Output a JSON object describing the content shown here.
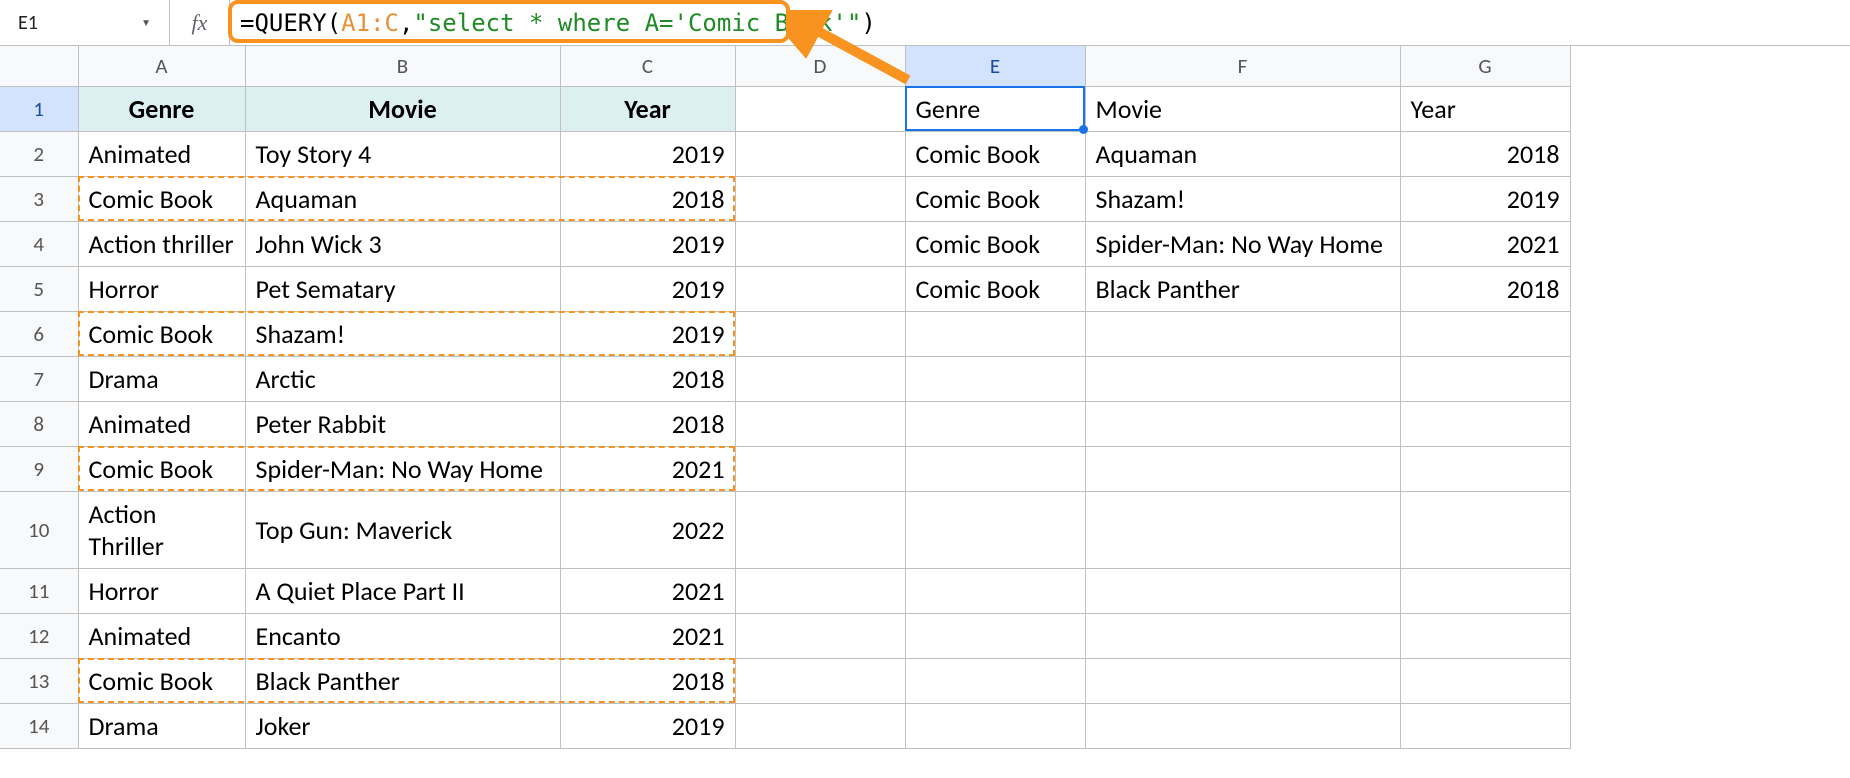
{
  "namebox": {
    "value": "E1"
  },
  "formula": {
    "eq": "=",
    "fn": "QUERY",
    "open": "(",
    "range": "A1:C",
    "comma": ",",
    "str": "\"select * where A='Comic Book'\"",
    "close": ")"
  },
  "columns": [
    "A",
    "B",
    "C",
    "D",
    "E",
    "F",
    "G"
  ],
  "rowNumbers": [
    "1",
    "2",
    "3",
    "4",
    "5",
    "6",
    "7",
    "8",
    "9",
    "10",
    "11",
    "12",
    "13",
    "14"
  ],
  "left": {
    "headers": {
      "genre": "Genre",
      "movie": "Movie",
      "year": "Year"
    },
    "rows": [
      {
        "genre": "Animated",
        "movie": "Toy Story 4",
        "year": "2019"
      },
      {
        "genre": "Comic Book",
        "movie": "Aquaman",
        "year": "2018"
      },
      {
        "genre": "Action thriller",
        "movie": "John Wick 3",
        "year": "2019"
      },
      {
        "genre": "Horror",
        "movie": "Pet Sematary",
        "year": "2019"
      },
      {
        "genre": "Comic Book",
        "movie": "Shazam!",
        "year": "2019"
      },
      {
        "genre": "Drama",
        "movie": "Arctic",
        "year": "2018"
      },
      {
        "genre": "Animated",
        "movie": "Peter Rabbit",
        "year": "2018"
      },
      {
        "genre": "Comic Book",
        "movie": "Spider-Man: No Way Home",
        "year": "2021"
      },
      {
        "genre": "Action Thriller",
        "movie": "Top Gun: Maverick",
        "year": "2022"
      },
      {
        "genre": "Horror",
        "movie": "A Quiet Place Part II",
        "year": "2021"
      },
      {
        "genre": "Animated",
        "movie": "Encanto",
        "year": "2021"
      },
      {
        "genre": "Comic Book",
        "movie": "Black Panther",
        "year": "2018"
      },
      {
        "genre": "Drama",
        "movie": "Joker",
        "year": "2019"
      }
    ]
  },
  "right": {
    "headers": {
      "genre": "Genre",
      "movie": "Movie",
      "year": "Year"
    },
    "rows": [
      {
        "genre": "Comic Book",
        "movie": "Aquaman",
        "year": "2018"
      },
      {
        "genre": "Comic Book",
        "movie": "Shazam!",
        "year": "2019"
      },
      {
        "genre": "Comic Book",
        "movie": "Spider-Man: No Way Home",
        "year": "2021"
      },
      {
        "genre": "Comic Book",
        "movie": "Black Panther",
        "year": "2018"
      }
    ]
  }
}
